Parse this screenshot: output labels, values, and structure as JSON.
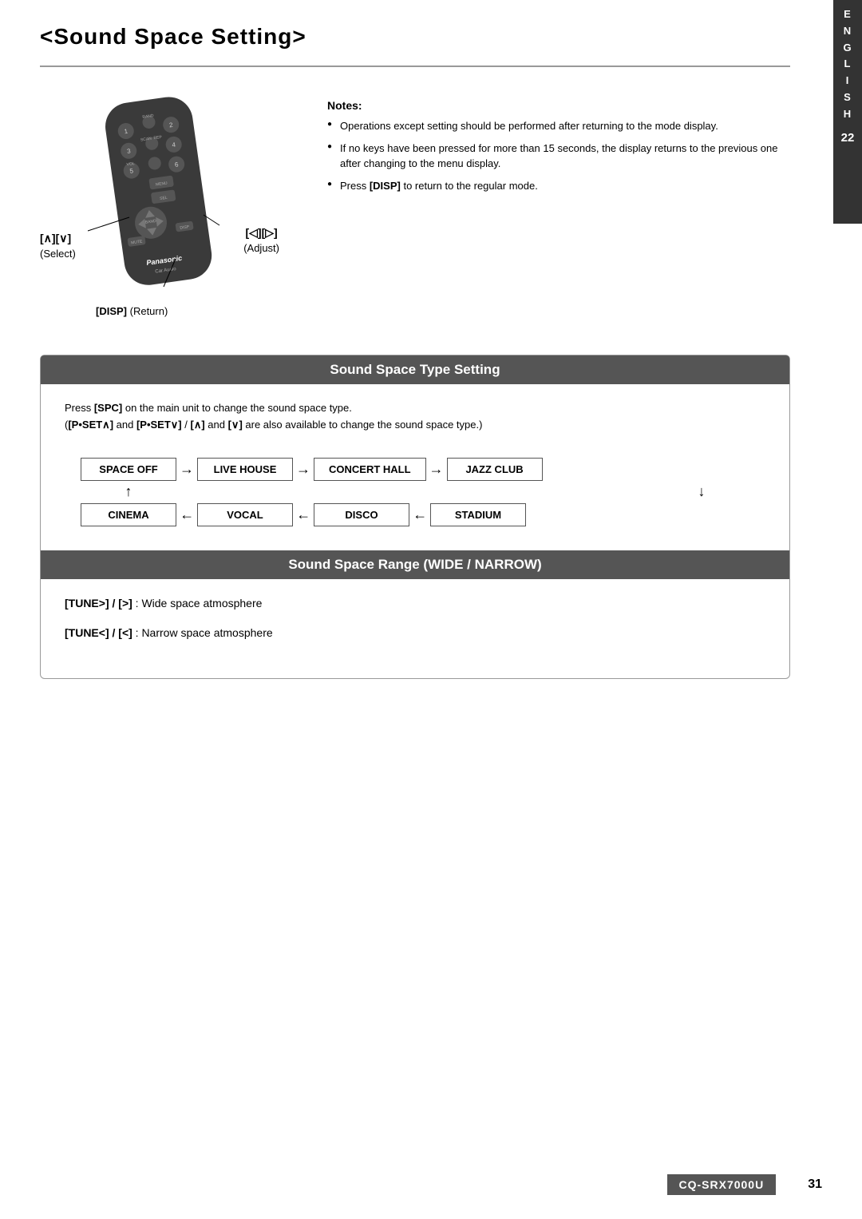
{
  "page": {
    "title": "<Sound Space Setting>",
    "title_prefix": "<",
    "title_text": "Sound Space Setting",
    "title_suffix": ">"
  },
  "sidebar": {
    "letters": [
      "E",
      "N",
      "G",
      "L",
      "I",
      "S",
      "H"
    ],
    "page_num": "22"
  },
  "notes": {
    "title": "Notes:",
    "items": [
      "Operations except setting should be performed after returning to the mode display.",
      "If no keys have been pressed for more than 15 seconds, the display returns to the previous one after changing to the menu display.",
      "Press [DISP] to return to the regular mode."
    ]
  },
  "remote": {
    "select_label": "(Select)",
    "select_keys": "[∧][∨]",
    "adjust_label": "(Adjust)",
    "adjust_keys": "[◁][▷]",
    "disp_label": "[DISP] (Return)"
  },
  "type_section": {
    "header": "Sound Space Type Setting",
    "desc_line1": "Press [SPC] on the main unit to change the sound space type.",
    "desc_line2": "([P•SET∧] and [P•SET∨] / [∧] and [∨] are also available to change the sound space type.)",
    "flow_top": [
      "SPACE OFF",
      "LIVE HOUSE",
      "CONCERT HALL",
      "JAZZ CLUB"
    ],
    "flow_bottom": [
      "CINEMA",
      "VOCAL",
      "DISCO",
      "STADIUM"
    ]
  },
  "range_section": {
    "header": "Sound Space Range (WIDE / NARROW)",
    "items": [
      {
        "key": "[TUNE>] / [>]",
        "desc": ": Wide space atmosphere"
      },
      {
        "key": "[TUNE<] / [<]",
        "desc": ": Narrow space atmosphere"
      }
    ]
  },
  "footer": {
    "model": "CQ-SRX7000U",
    "page": "31"
  }
}
